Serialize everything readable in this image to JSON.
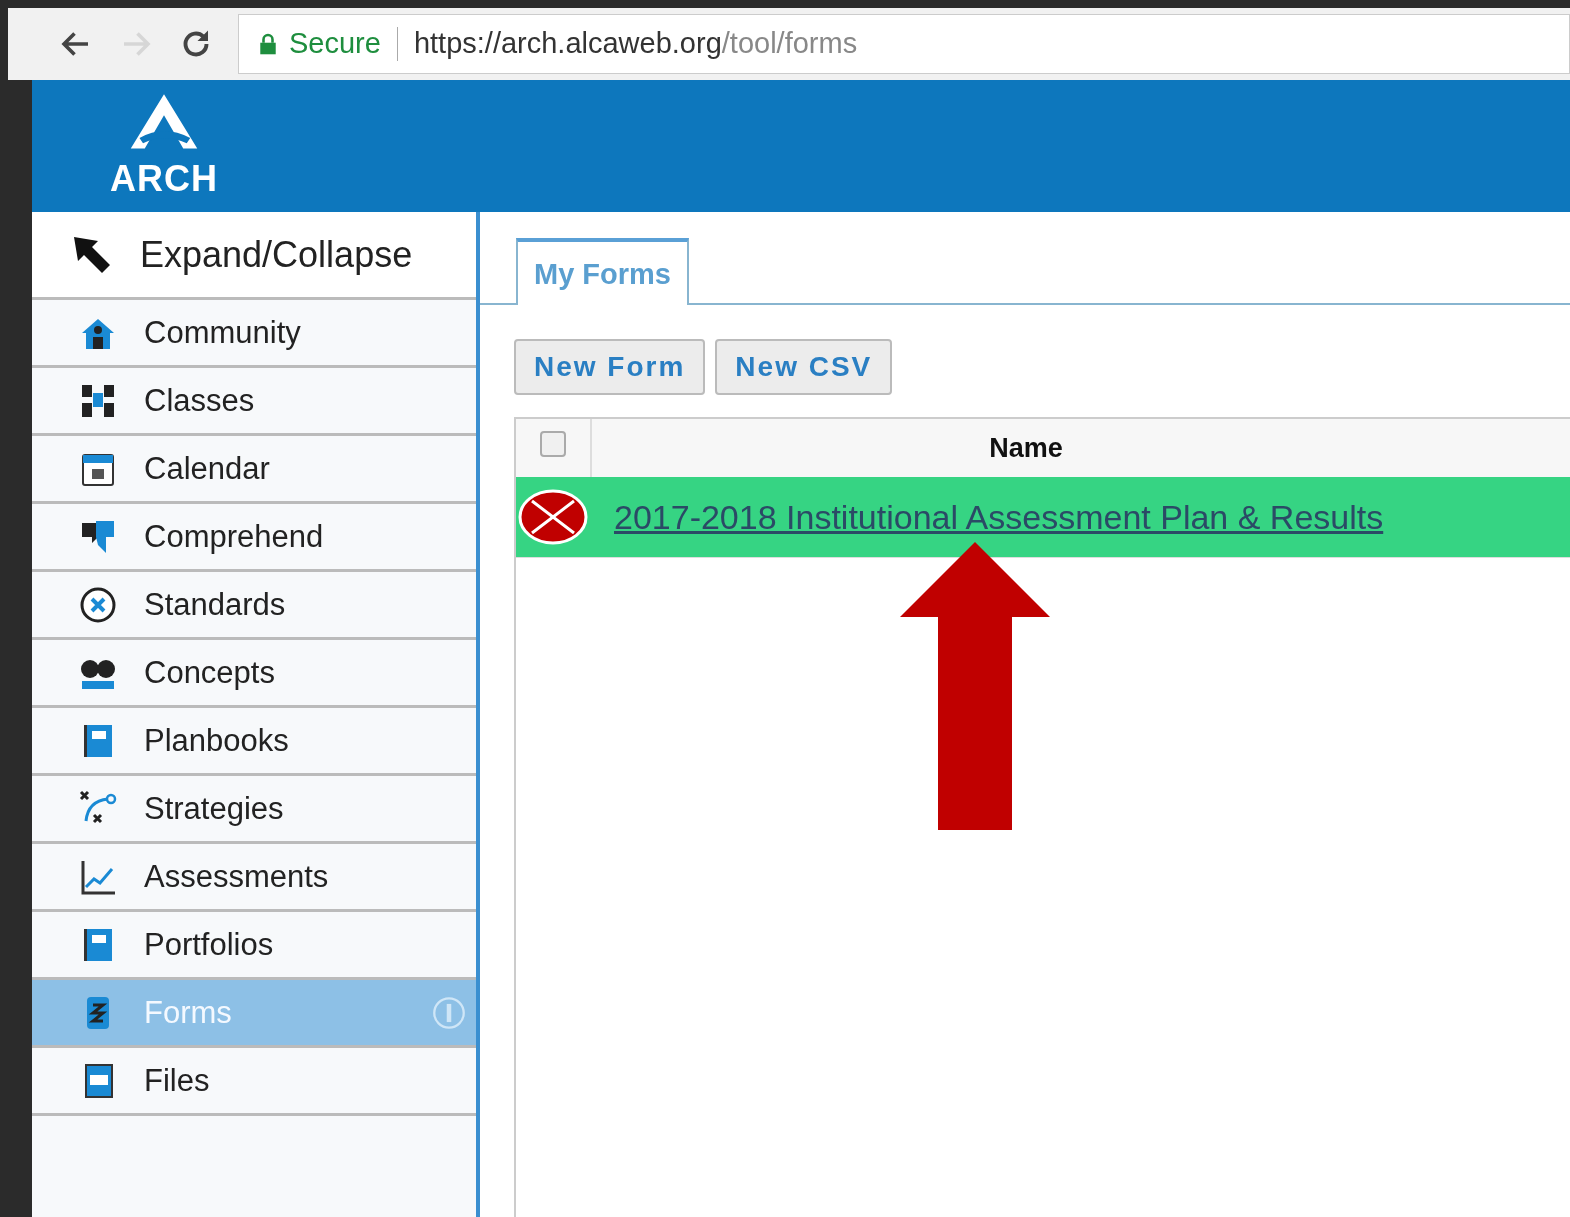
{
  "browser": {
    "secure_label": "Secure",
    "url_host": "https://arch.alcaweb.org",
    "url_path": "/tool/forms"
  },
  "header": {
    "logo_text": "ARCH"
  },
  "sidebar": {
    "toggle_label": "Expand/Collapse",
    "items": [
      {
        "label": "Community",
        "selected": false
      },
      {
        "label": "Classes",
        "selected": false
      },
      {
        "label": "Calendar",
        "selected": false
      },
      {
        "label": "Comprehend",
        "selected": false
      },
      {
        "label": "Standards",
        "selected": false
      },
      {
        "label": "Concepts",
        "selected": false
      },
      {
        "label": "Planbooks",
        "selected": false
      },
      {
        "label": "Strategies",
        "selected": false
      },
      {
        "label": "Assessments",
        "selected": false
      },
      {
        "label": "Portfolios",
        "selected": false
      },
      {
        "label": "Forms",
        "selected": true
      },
      {
        "label": "Files",
        "selected": false
      }
    ]
  },
  "tabs": [
    {
      "label": "My Forms",
      "selected": true
    }
  ],
  "buttons": [
    "New Form",
    "New CSV"
  ],
  "table": {
    "columns": [
      "Name"
    ],
    "select_all_checked": false,
    "rows": [
      {
        "name": "2017-2018 Institutional Assessment Plan & Results",
        "highlighted": true
      }
    ]
  }
}
